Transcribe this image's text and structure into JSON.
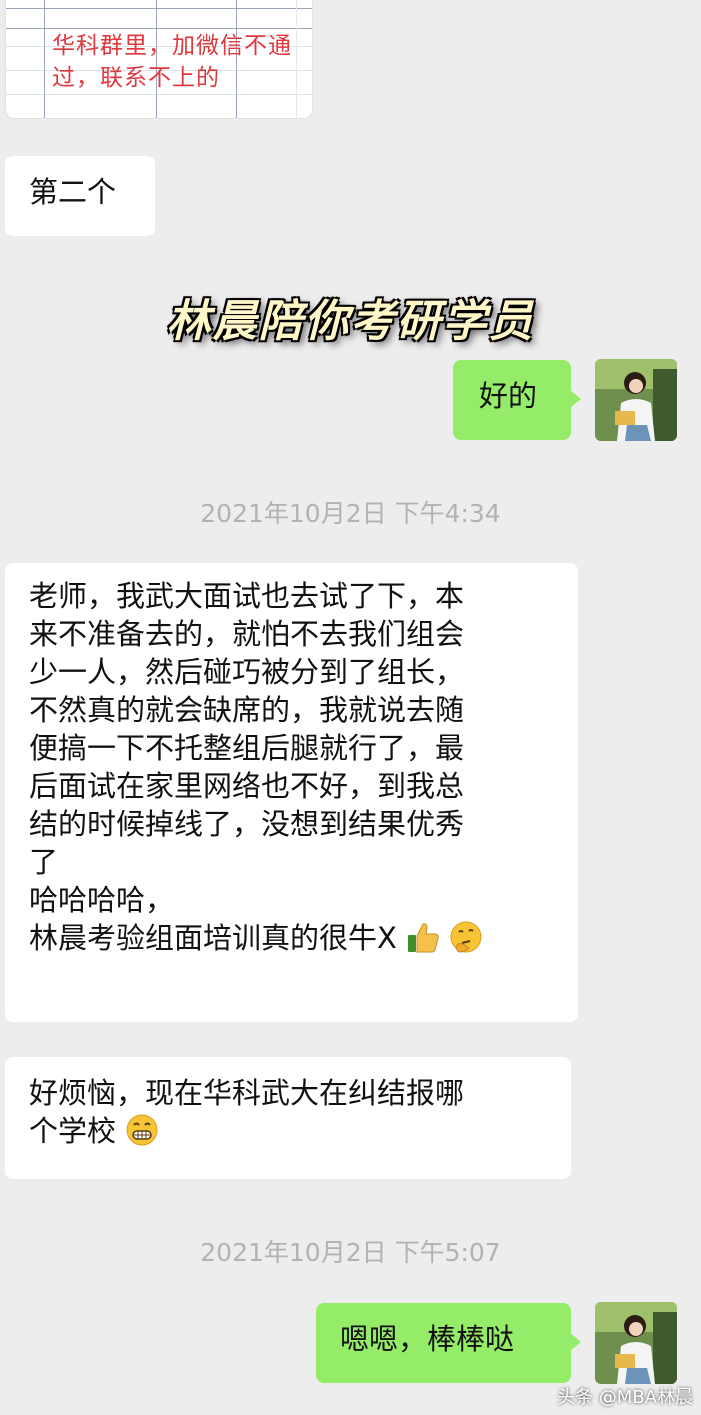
{
  "sheet_text": "华科群里，加微信不通过，联系不上的",
  "overlay_title": "林晨陪你考研学员",
  "messages": {
    "m1": "第二个",
    "m2": "好的",
    "m3_lines": [
      "老师，我武大面试也去试了下，本",
      "来不准备去的，就怕不去我们组会",
      "少一人，然后碰巧被分到了组长，",
      "不然真的就会缺席的，我就说去随",
      "便搞一下不托整组后腿就行了，最",
      "后面试在家里网络也不好，到我总",
      "结的时候掉线了，没想到结果优秀",
      "了",
      "哈哈哈哈，",
      "林晨考验组面培训真的很牛X"
    ],
    "m4_lines": [
      "好烦恼，现在华科武大在纠结报哪",
      "个学校"
    ],
    "m5": "嗯嗯，棒棒哒"
  },
  "timestamps": {
    "t1": "2021年10月2日 下午4:34",
    "t2": "2021年10月2日 下午5:07"
  },
  "emojis": [
    "thumbs-up-icon",
    "thinking-face-icon",
    "grimacing-face-icon"
  ],
  "watermark": "头条 @MBA林晨",
  "colors": {
    "background": "#ededed",
    "my_bubble": "#95ec69",
    "their_bubble": "#ffffff",
    "sheet_text": "#e0383d"
  }
}
